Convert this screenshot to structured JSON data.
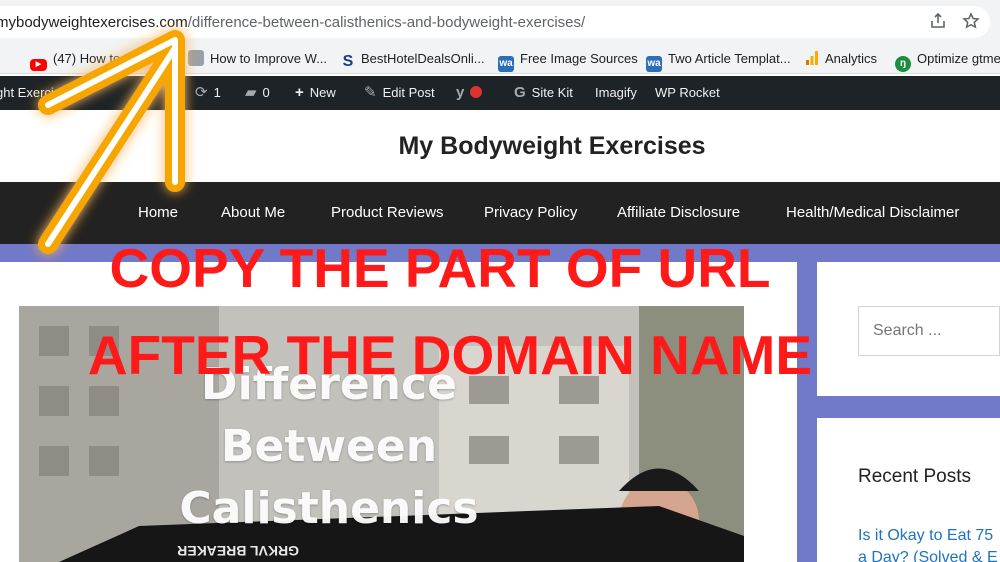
{
  "address_bar": {
    "url_domain": "mybodyweightexercises.com",
    "url_path": "/difference-between-calisthenics-and-bodyweight-exercises/",
    "share_icon": "share-icon",
    "bookmark_icon": "star-icon"
  },
  "bookmarks": [
    {
      "label": "(47) How to Im",
      "icon": "youtube-icon",
      "color": "#ff0000"
    },
    {
      "label": "How to Improve W...",
      "icon": "page-icon",
      "color": "#6f6f6f"
    },
    {
      "label": "BestHotelDealsOnli...",
      "icon": "s-logo-icon",
      "color": "#1a3a8f"
    },
    {
      "label": "Free Image Sources",
      "icon": "wa-icon",
      "color": "#2a6fb7"
    },
    {
      "label": "Two Article Templat...",
      "icon": "wa-icon",
      "color": "#2a6fb7"
    },
    {
      "label": "Analytics",
      "icon": "analytics-icon",
      "color": "#f9ab00"
    },
    {
      "label": "Optimize gtme",
      "icon": "optimize-icon",
      "color": "#1e8e3e"
    }
  ],
  "admin_bar": {
    "site_name": "ght Exercise",
    "updates_count": "1",
    "comments_count": "0",
    "new_label": "New",
    "edit_post_label": "Edit Post",
    "site_kit_label": "Site Kit",
    "imagify_label": "Imagify",
    "wp_rocket_label": "WP Rocket"
  },
  "site": {
    "title": "My Bodyweight Exercises"
  },
  "nav": [
    "Home",
    "About Me",
    "Product Reviews",
    "Privacy Policy",
    "Affiliate Disclosure",
    "Health/Medical Disclaimer"
  ],
  "hero": {
    "title_line1": "Difference",
    "title_line2": "Between",
    "title_line3": "Calisthenics",
    "shirt_text": "GRKVL BREAKER"
  },
  "sidebar": {
    "search_placeholder": "Search ...",
    "recent_posts_title": "Recent Posts",
    "recent_post_line1": "Is it Okay to Eat 75",
    "recent_post_line2": "a Day? (Solved & E"
  },
  "overlay": {
    "line1": "COPY THE PART OF URL",
    "line2": "AFTER THE DOMAIN NAME",
    "color": "#ff1a1a",
    "arrow_color": "#f7a600"
  }
}
